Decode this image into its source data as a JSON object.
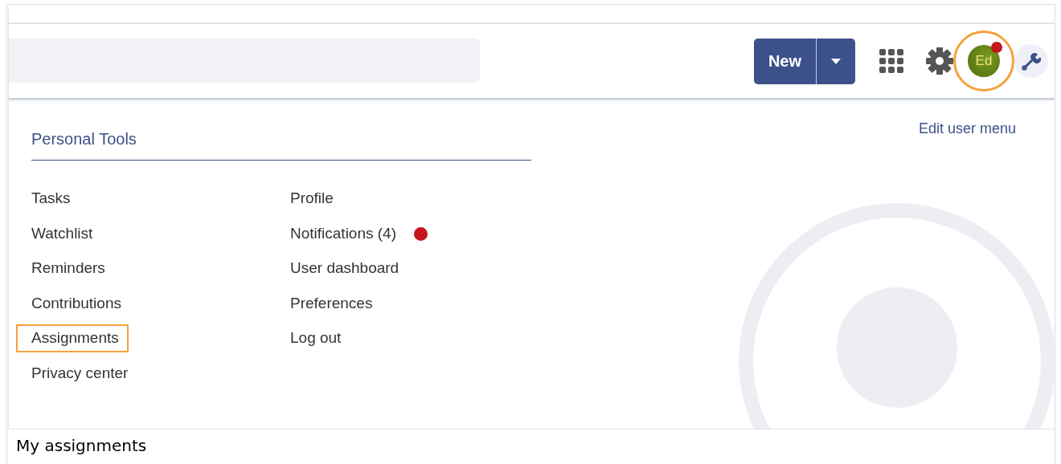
{
  "header": {
    "new_button": "New",
    "avatar": {
      "initials": "Ed",
      "has_notification": true,
      "highlighted": true
    }
  },
  "menu": {
    "title": "Personal Tools",
    "edit_link": "Edit user menu",
    "columns": [
      [
        {
          "label": "Tasks",
          "highlighted": false,
          "has_notification": false
        },
        {
          "label": "Watchlist",
          "highlighted": false,
          "has_notification": false
        },
        {
          "label": "Reminders",
          "highlighted": false,
          "has_notification": false
        },
        {
          "label": "Contributions",
          "highlighted": false,
          "has_notification": false
        },
        {
          "label": "Assignments",
          "highlighted": true,
          "has_notification": false
        },
        {
          "label": "Privacy center",
          "highlighted": false,
          "has_notification": false
        }
      ],
      [
        {
          "label": "Profile",
          "highlighted": false,
          "has_notification": false
        },
        {
          "label": "Notifications (4)",
          "highlighted": false,
          "has_notification": true
        },
        {
          "label": "User dashboard",
          "highlighted": false,
          "has_notification": false
        },
        {
          "label": "Preferences",
          "highlighted": false,
          "has_notification": false
        },
        {
          "label": "Log out",
          "highlighted": false,
          "has_notification": false
        }
      ]
    ]
  },
  "caption": "My assignments"
}
